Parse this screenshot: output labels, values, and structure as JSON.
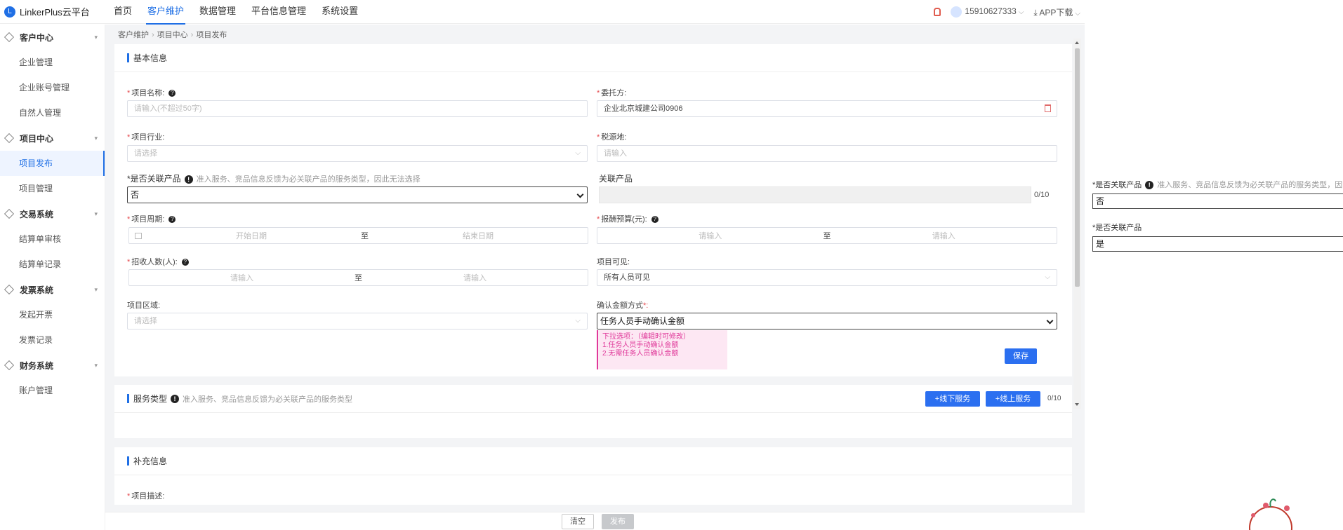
{
  "app": {
    "logo_text": "LinkerPlus云平台"
  },
  "topnav": [
    {
      "label": "首页",
      "active": false
    },
    {
      "label": "客户维护",
      "active": true
    },
    {
      "label": "数据管理",
      "active": false
    },
    {
      "label": "平台信息管理",
      "active": false
    },
    {
      "label": "系统设置",
      "active": false
    }
  ],
  "user": {
    "phone": "15910627333",
    "app_download": "APP下载"
  },
  "sidebar": {
    "groups": [
      {
        "label": "客户中心",
        "items": [
          "企业管理",
          "企业账号管理",
          "自然人管理"
        ]
      },
      {
        "label": "项目中心",
        "items": [
          "项目发布",
          "项目管理"
        ]
      },
      {
        "label": "交易系统",
        "items": [
          "结算单审核",
          "结算单记录"
        ]
      },
      {
        "label": "发票系统",
        "items": [
          "发起开票",
          "发票记录"
        ]
      },
      {
        "label": "财务系统",
        "items": [
          "账户管理"
        ]
      }
    ],
    "active_item": "项目发布"
  },
  "breadcrumb": [
    "客户维护",
    "项目中心",
    "项目发布"
  ],
  "basic_info": {
    "title": "基本信息",
    "project_name": {
      "label": "项目名称:",
      "placeholder": "请输入(不超过50字)"
    },
    "client": {
      "label": "委托方:",
      "value": "企业北京城建公司0906"
    },
    "industry": {
      "label": "项目行业:",
      "placeholder": "请选择"
    },
    "tax_source": {
      "label": "税源地:",
      "placeholder": "请输入"
    },
    "related_product": {
      "label": "*是否关联产品",
      "hint": "准入服务、竞品信息反馈为必关联产品的服务类型，因此无法选择",
      "value": "否"
    },
    "related_products": {
      "label": "关联产品",
      "counter": "0/10"
    },
    "period": {
      "label": "项目周期:",
      "start_placeholder": "开始日期",
      "separator": "至",
      "end_placeholder": "结束日期"
    },
    "budget": {
      "label": "报酬预算(元):",
      "start_placeholder": "请输入",
      "separator": "至",
      "end_placeholder": "请输入"
    },
    "recruit": {
      "label": "招收人数(人):",
      "start_placeholder": "请输入",
      "separator": "至",
      "end_placeholder": "请输入"
    },
    "visibility": {
      "label": "项目可见:",
      "value": "所有人员可见"
    },
    "region": {
      "label": "项目区域:",
      "placeholder": "请选择"
    },
    "confirm_amount": {
      "label": "确认金额方式",
      "required_mark": "*:",
      "value": "任务人员手动确认金额"
    },
    "note_lines": [
      "下拉选项：（编辑时可修改）",
      "1.任务人员手动确认金额",
      "2.无需任务人员确认金额"
    ],
    "save_label": "保存"
  },
  "service_type": {
    "title": "服务类型",
    "hint": "准入服务、竞品信息反馈为必关联产品的服务类型",
    "offline_label": "+线下服务",
    "online_label": "+线上服务",
    "counter": "0/10"
  },
  "supplement": {
    "title": "补充信息",
    "description_label": "项目描述:"
  },
  "footer": {
    "clear_label": "清空",
    "publish_label": "发布"
  },
  "side_demo": {
    "row1": {
      "label": "*是否关联产品",
      "hint": "准入服务、竞品信息反馈为必关联产品的服务类型，因",
      "value": "否"
    },
    "row2": {
      "label": "*是否关联产品",
      "value": "是"
    }
  }
}
